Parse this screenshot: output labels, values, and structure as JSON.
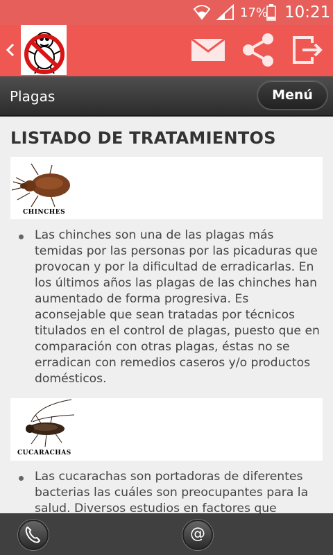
{
  "status_bar": {
    "battery": "17%",
    "time": "10:21"
  },
  "app_bar": {
    "icons": [
      "back-icon",
      "logo",
      "mail-icon",
      "share-icon",
      "exit-icon"
    ]
  },
  "title_bar": {
    "title": "Plagas",
    "menu_label": "Menú"
  },
  "content": {
    "heading": "LISTADO DE TRATAMIENTOS",
    "items": [
      {
        "caption": "CHINCHES",
        "text": "Las chinches son una de las plagas más temidas por las personas por las picaduras que provocan y por la dificultad de erradicarlas. En los últimos años las plagas de las chinches han aumentado de forma progresiva. Es aconsejable que sean tratadas por técnicos titulados en el control de plagas, puesto que en comparación con otras plagas, éstas no se erradican con remedios caseros y/o productos domésticos."
      },
      {
        "caption": "CUCARACHAS",
        "text": "Las cucarachas son portadoras de diferentes bacterias las cuáles son preocupantes para la salud. Diversos estudios en factores que predisponen al asma en las ciudades demostraba que los alergenos provenientes de cucarachas pueden empeorar los síntomas"
      }
    ]
  },
  "bottom_bar": {
    "email_symbol": "@"
  },
  "colors": {
    "status_bar": "#e65f5a",
    "app_bar": "#ef5753",
    "title_bar": "#3a3a3a",
    "background": "#efefef"
  }
}
